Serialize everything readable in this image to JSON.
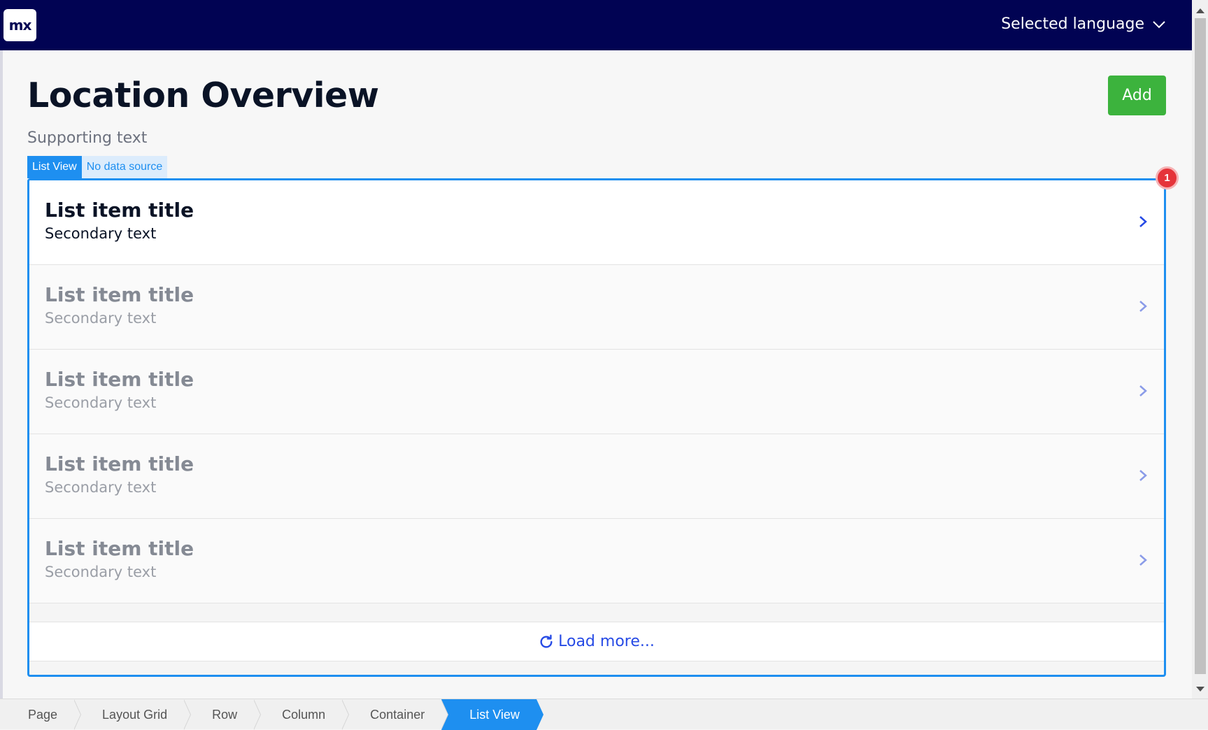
{
  "topbar": {
    "logo_text": "mx",
    "language_label": "Selected language"
  },
  "header": {
    "title": "Location Overview",
    "supporting_text": "Supporting text",
    "add_label": "Add"
  },
  "widget": {
    "name": "List View",
    "source": "No data source",
    "error_count": "1"
  },
  "list": {
    "items": [
      {
        "title": "List item title",
        "subtitle": "Secondary text"
      },
      {
        "title": "List item title",
        "subtitle": "Secondary text"
      },
      {
        "title": "List item title",
        "subtitle": "Secondary text"
      },
      {
        "title": "List item title",
        "subtitle": "Secondary text"
      },
      {
        "title": "List item title",
        "subtitle": "Secondary text"
      }
    ],
    "load_more": "Load more..."
  },
  "breadcrumb": {
    "items": [
      "Page",
      "Layout Grid",
      "Row",
      "Column",
      "Container",
      "List View"
    ]
  },
  "colors": {
    "topbar": "#010353",
    "add_button": "#3cb33d",
    "accent": "#1e8ff0",
    "link": "#264ae5",
    "error_badge": "#e5343a"
  },
  "icons": {
    "language_dropdown": "chevron-down-icon",
    "list_item": "chevron-right-icon",
    "load_more": "refresh-icon"
  }
}
